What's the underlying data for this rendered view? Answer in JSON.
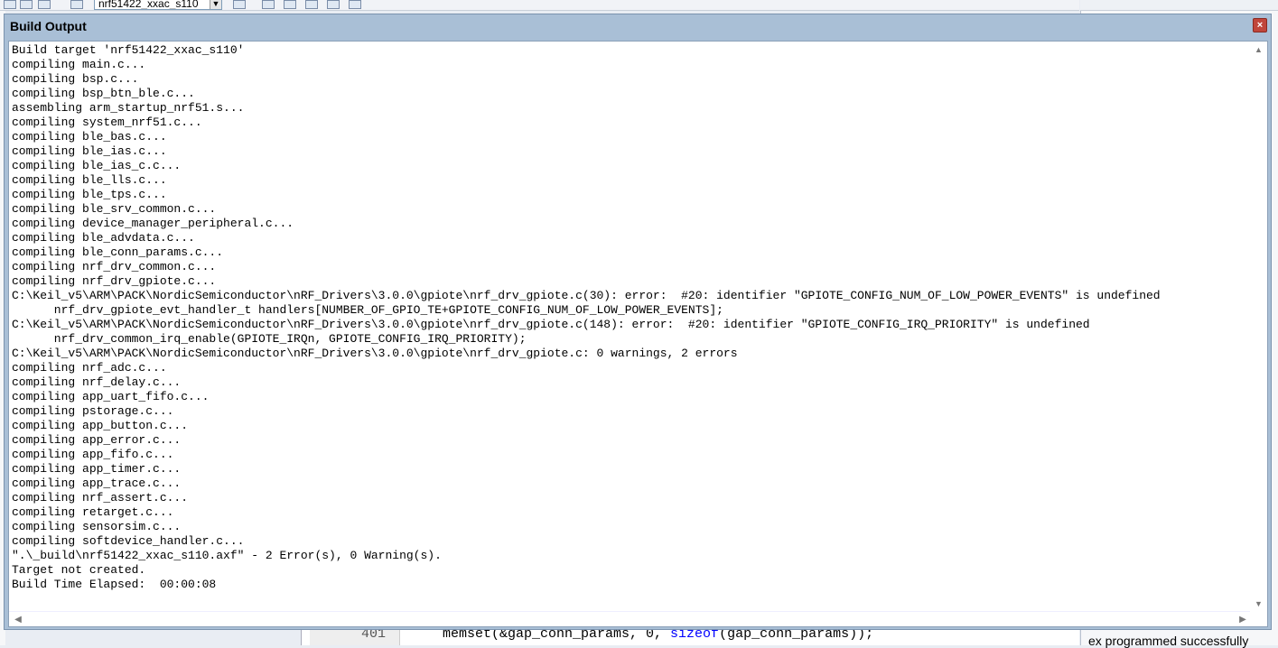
{
  "toolbar": {
    "target_combo": "nrf51422_xxac_s110"
  },
  "panel": {
    "title": "Build Output",
    "close_glyph": "×"
  },
  "output_lines": [
    "Build target 'nrf51422_xxac_s110'",
    "compiling main.c...",
    "compiling bsp.c...",
    "compiling bsp_btn_ble.c...",
    "assembling arm_startup_nrf51.s...",
    "compiling system_nrf51.c...",
    "compiling ble_bas.c...",
    "compiling ble_ias.c...",
    "compiling ble_ias_c.c...",
    "compiling ble_lls.c...",
    "compiling ble_tps.c...",
    "compiling ble_srv_common.c...",
    "compiling device_manager_peripheral.c...",
    "compiling ble_advdata.c...",
    "compiling ble_conn_params.c...",
    "compiling nrf_drv_common.c...",
    "compiling nrf_drv_gpiote.c...",
    "C:\\Keil_v5\\ARM\\PACK\\NordicSemiconductor\\nRF_Drivers\\3.0.0\\gpiote\\nrf_drv_gpiote.c(30): error:  #20: identifier \"GPIOTE_CONFIG_NUM_OF_LOW_POWER_EVENTS\" is undefined",
    "      nrf_drv_gpiote_evt_handler_t handlers[NUMBER_OF_GPIO_TE+GPIOTE_CONFIG_NUM_OF_LOW_POWER_EVENTS];",
    "C:\\Keil_v5\\ARM\\PACK\\NordicSemiconductor\\nRF_Drivers\\3.0.0\\gpiote\\nrf_drv_gpiote.c(148): error:  #20: identifier \"GPIOTE_CONFIG_IRQ_PRIORITY\" is undefined",
    "      nrf_drv_common_irq_enable(GPIOTE_IRQn, GPIOTE_CONFIG_IRQ_PRIORITY);",
    "C:\\Keil_v5\\ARM\\PACK\\NordicSemiconductor\\nRF_Drivers\\3.0.0\\gpiote\\nrf_drv_gpiote.c: 0 warnings, 2 errors",
    "compiling nrf_adc.c...",
    "compiling nrf_delay.c...",
    "compiling app_uart_fifo.c...",
    "compiling pstorage.c...",
    "compiling app_button.c...",
    "compiling app_error.c...",
    "compiling app_fifo.c...",
    "compiling app_timer.c...",
    "compiling app_trace.c...",
    "compiling nrf_assert.c...",
    "compiling retarget.c...",
    "compiling sensorsim.c...",
    "compiling softdevice_handler.c...",
    "\".\\_build\\nrf51422_xxac_s110.axf\" - 2 Error(s), 0 Warning(s).",
    "Target not created.",
    "Build Time Elapsed:  00:00:08"
  ],
  "background": {
    "editor_line_number": "401",
    "editor_code_pre": "memset(&gap_conn_params, 0, ",
    "editor_code_kw": "sizeof",
    "editor_code_post": "(gap_conn_params));",
    "status_text": "ex programmed successfully"
  },
  "icons": [
    "close-icon",
    "scroll-up-icon",
    "scroll-down-icon",
    "scroll-left-icon",
    "scroll-right-icon"
  ]
}
